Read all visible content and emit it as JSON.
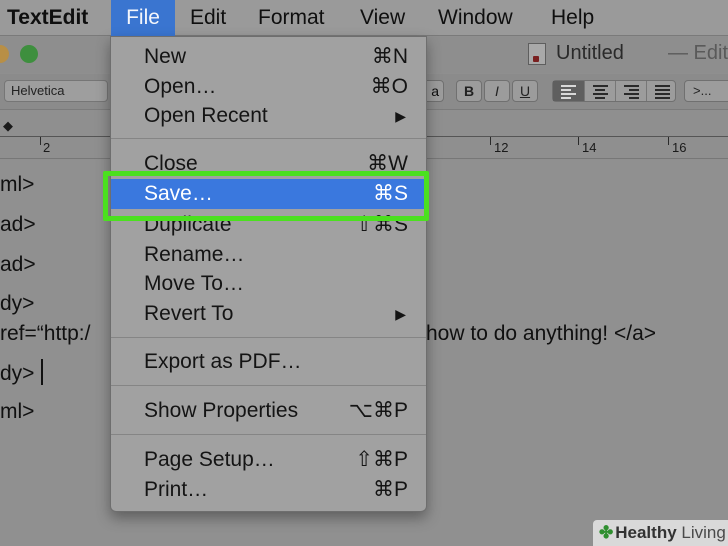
{
  "menubar": {
    "app": "TextEdit",
    "items": [
      "File",
      "Edit",
      "Format",
      "View",
      "Window",
      "Help"
    ]
  },
  "window": {
    "title": "Untitled",
    "status": "— Edited"
  },
  "toolbar": {
    "font": "Helvetica",
    "partial_button": "a",
    "bold": "B",
    "italic": "I",
    "underline": "U",
    "more": ">..."
  },
  "ruler": {
    "labels": [
      "2",
      "12",
      "14",
      "16"
    ]
  },
  "document": {
    "lines": [
      "ml>",
      "ad>",
      "ad>",
      "dy>",
      "ref=“http:/",
      "dy>",
      "ml>"
    ],
    "trailing_text": "how to do anything! </a>"
  },
  "file_menu": {
    "items": [
      {
        "label": "New",
        "shortcut": "⌘N"
      },
      {
        "label": "Open…",
        "shortcut": "⌘O"
      },
      {
        "label": "Open Recent",
        "shortcut": ""
      },
      {
        "label": "Close",
        "shortcut": "⌘W"
      },
      {
        "label": "Save…",
        "shortcut": "⌘S"
      },
      {
        "label": "Duplicate",
        "shortcut": "⇧⌘S"
      },
      {
        "label": "Rename…",
        "shortcut": ""
      },
      {
        "label": "Move To…",
        "shortcut": ""
      },
      {
        "label": "Revert To",
        "shortcut": ""
      },
      {
        "label": "Export as PDF…",
        "shortcut": ""
      },
      {
        "label": "Show Properties",
        "shortcut": "⌥⌘P"
      },
      {
        "label": "Page Setup…",
        "shortcut": "⇧⌘P"
      },
      {
        "label": "Print…",
        "shortcut": "⌘P"
      }
    ],
    "selected": "Save…"
  },
  "watermark": {
    "brand": "Healthy",
    "brand2": "Living"
  },
  "colors": {
    "menu_highlight": "#3a78de",
    "annotation_box": "#4be01f"
  }
}
